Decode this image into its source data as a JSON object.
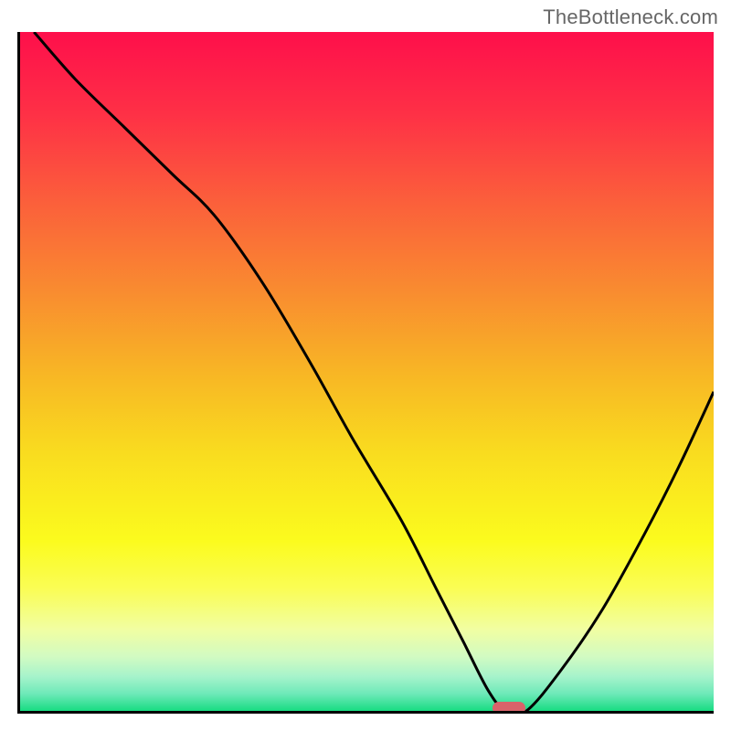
{
  "watermark": "TheBottleneck.com",
  "colors": {
    "curve": "#000000",
    "marker": "#d9636a",
    "gradient_stops": [
      {
        "pos": 0.0,
        "color": "#fe0f4b"
      },
      {
        "pos": 0.12,
        "color": "#fe3046"
      },
      {
        "pos": 0.25,
        "color": "#fb5f3b"
      },
      {
        "pos": 0.38,
        "color": "#f98b30"
      },
      {
        "pos": 0.5,
        "color": "#f8b525"
      },
      {
        "pos": 0.62,
        "color": "#f9dc1f"
      },
      {
        "pos": 0.75,
        "color": "#fbfb1e"
      },
      {
        "pos": 0.82,
        "color": "#fafd55"
      },
      {
        "pos": 0.88,
        "color": "#f1fea2"
      },
      {
        "pos": 0.92,
        "color": "#d2fbc2"
      },
      {
        "pos": 0.95,
        "color": "#a5f3cb"
      },
      {
        "pos": 0.975,
        "color": "#6de9b8"
      },
      {
        "pos": 1.0,
        "color": "#18dc82"
      }
    ]
  },
  "chart_data": {
    "type": "line",
    "title": "",
    "xlabel": "",
    "ylabel": "",
    "xlim": [
      0,
      100
    ],
    "ylim": [
      0,
      100
    ],
    "grid": false,
    "legend": false,
    "marker": {
      "x": 70.5,
      "y": 0
    },
    "series": [
      {
        "name": "curve",
        "x": [
          2,
          8,
          15,
          22,
          28,
          35,
          42,
          48,
          55,
          60,
          64,
          67.5,
          70,
          73,
          78,
          84,
          90,
          95,
          100
        ],
        "y": [
          100,
          93,
          86,
          79,
          73,
          63,
          51,
          40,
          28,
          18,
          10,
          3,
          0,
          0,
          6,
          15,
          26,
          36,
          47
        ]
      }
    ],
    "background_gradient_meaning": "vertical heat gradient; top=worst (red), bottom=best (green)"
  }
}
